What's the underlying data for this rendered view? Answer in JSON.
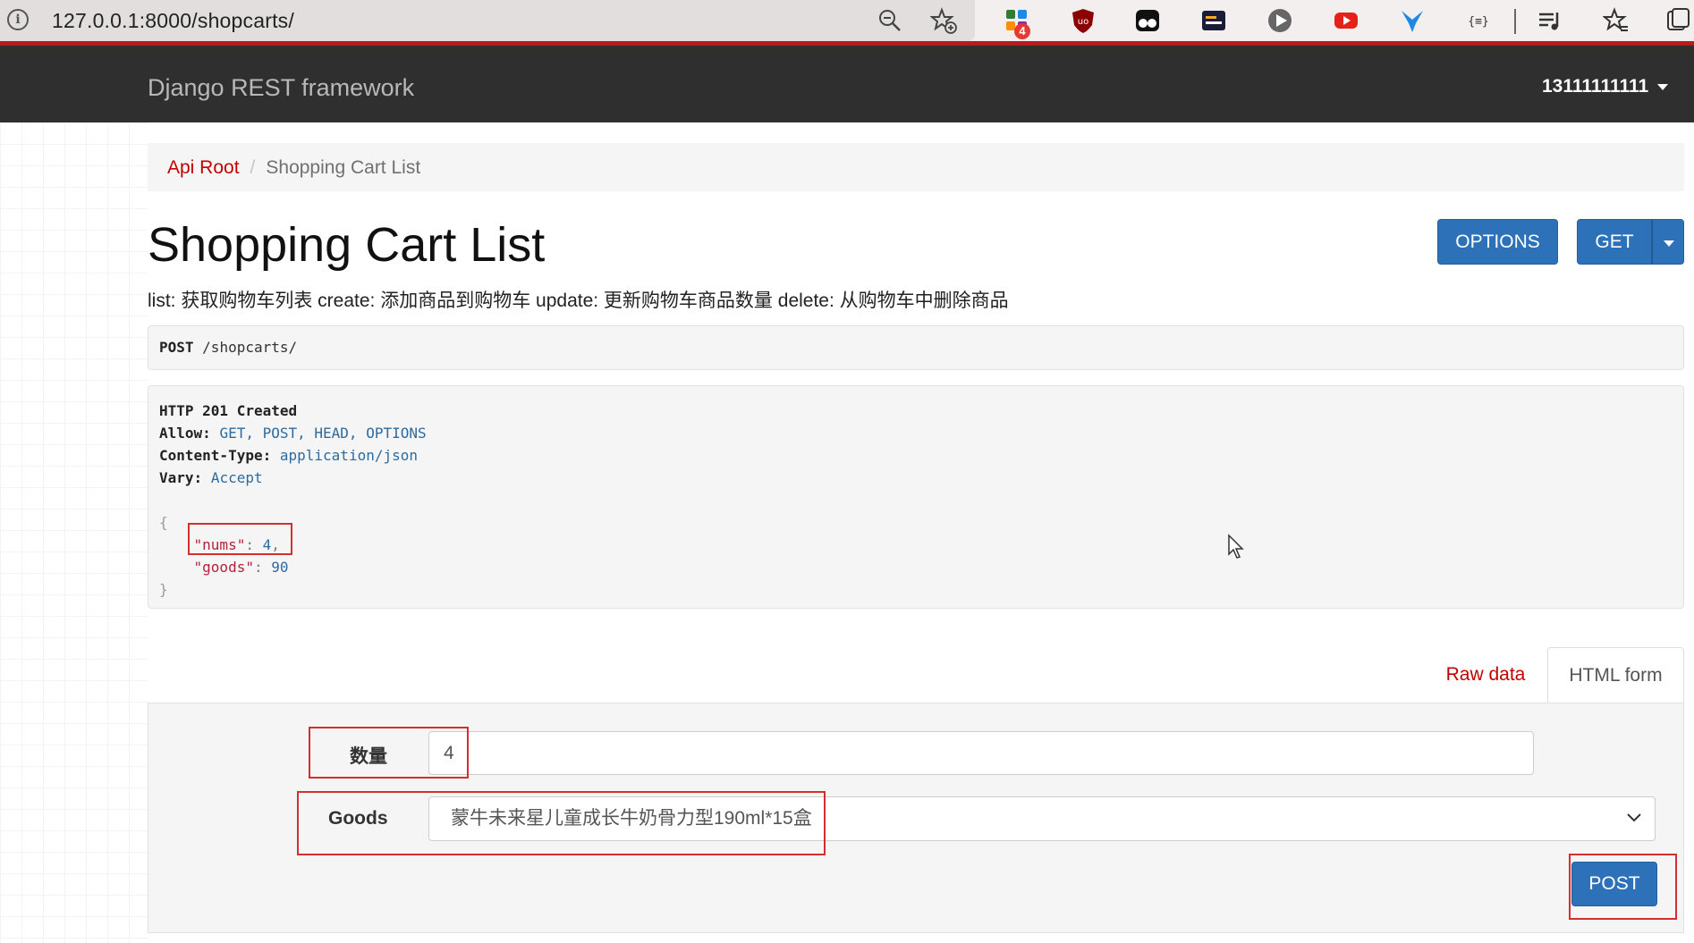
{
  "browser": {
    "url": "127.0.0.1:8000/shopcarts/",
    "info_icon_glyph": "i",
    "extension_badge": "4"
  },
  "navbar": {
    "brand": "Django REST framework",
    "user": "13111111111"
  },
  "breadcrumb": {
    "root": "Api Root",
    "separator": "/",
    "current": "Shopping Cart List"
  },
  "page": {
    "title": "Shopping Cart List",
    "description": "list: 获取购物车列表 create: 添加商品到购物车 update: 更新购物车商品数量 delete: 从购物车中删除商品",
    "options_label": "OPTIONS",
    "get_label": "GET"
  },
  "request": {
    "method": "POST",
    "path": "/shopcarts/"
  },
  "response": {
    "status": "HTTP 201 Created",
    "allow_key": "Allow:",
    "allow_value": "GET, POST, HEAD, OPTIONS",
    "content_type_key": "Content-Type:",
    "content_type_value": "application/json",
    "vary_key": "Vary:",
    "vary_value": "Accept",
    "open_brace": "{",
    "close_brace": "}",
    "nums_key": "\"nums\"",
    "nums_value": "4",
    "goods_key": "\"goods\"",
    "goods_value": "90"
  },
  "tabs": {
    "raw": "Raw data",
    "html": "HTML form"
  },
  "form": {
    "quantity_label": "数量",
    "quantity_value": "4",
    "goods_label": "Goods",
    "goods_selected": "蒙牛未来星儿童成长牛奶骨力型190ml*15盒",
    "post_label": "POST"
  },
  "colors": {
    "navbar": "#2f2f2f",
    "primary": "#2d72b9",
    "link": "#c20000",
    "annotation": "#d32f2f"
  }
}
